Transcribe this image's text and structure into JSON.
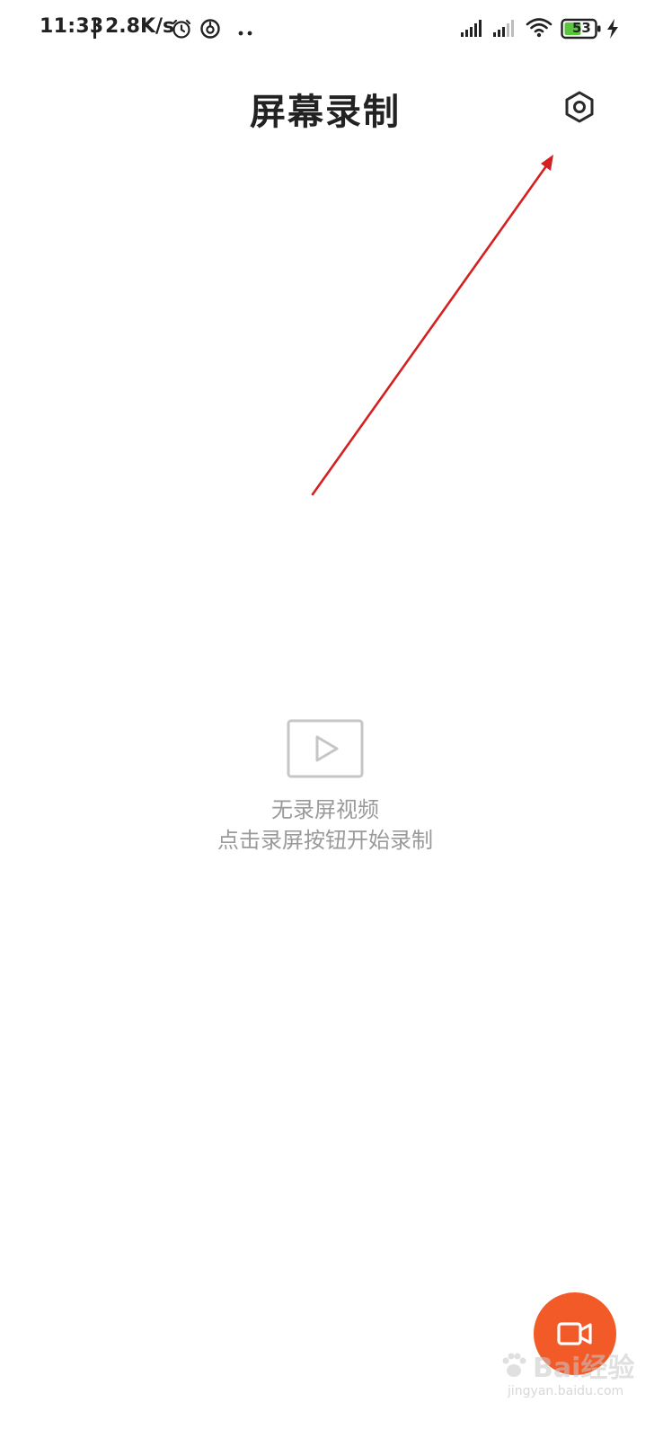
{
  "status_bar": {
    "time": "11:33",
    "net_speed": "2.8K/s",
    "battery_level": "53",
    "icons": [
      "alarm-icon",
      "netease-music-icon",
      "more-dots-icon",
      "signal-icon",
      "signal-weak-icon",
      "wifi-icon",
      "battery-icon",
      "charging-icon"
    ]
  },
  "header": {
    "title": "屏幕录制",
    "settings_icon": "gear-icon"
  },
  "empty_state": {
    "icon": "video-play-icon",
    "title": "无录屏视频",
    "subtitle": "点击录屏按钮开始录制"
  },
  "record_button": {
    "icon": "video-camera-icon",
    "color": "#f25a28"
  },
  "annotation": {
    "color": "#d42020"
  },
  "watermark": {
    "brand": "Bai经验",
    "site": "jingyan.baidu.com"
  }
}
